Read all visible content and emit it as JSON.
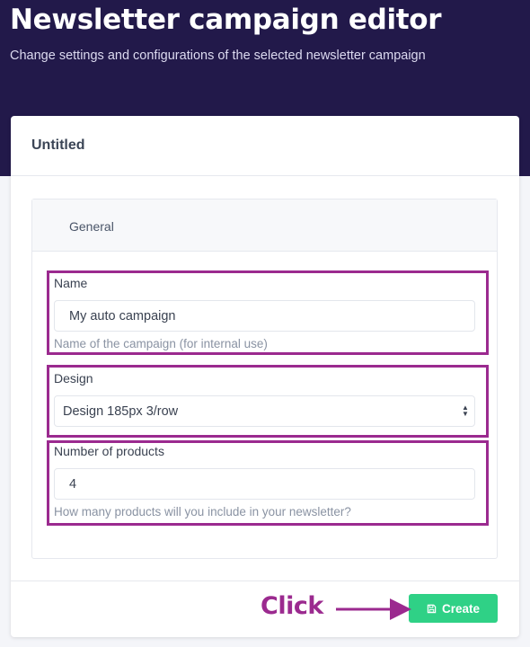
{
  "header": {
    "title": "Newsletter campaign editor",
    "subtitle": "Change settings and configurations of the selected newsletter campaign"
  },
  "card": {
    "title": "Untitled"
  },
  "panel": {
    "tab_label": "General"
  },
  "fields": {
    "name": {
      "label": "Name",
      "value": "My auto campaign",
      "help": "Name of the campaign (for internal use)"
    },
    "design": {
      "label": "Design",
      "selected": "Design 185px 3/row"
    },
    "products": {
      "label": "Number of products",
      "value": "4",
      "help": "How many products will you include in your newsletter?"
    }
  },
  "footer": {
    "create_label": "Create",
    "create_icon": "save-icon"
  },
  "annotation": {
    "label": "Click",
    "color": "#9b2a8f"
  },
  "colors": {
    "hero_bg": "#22194a",
    "accent_green": "#2fd186",
    "highlight": "#9b2a8f"
  }
}
